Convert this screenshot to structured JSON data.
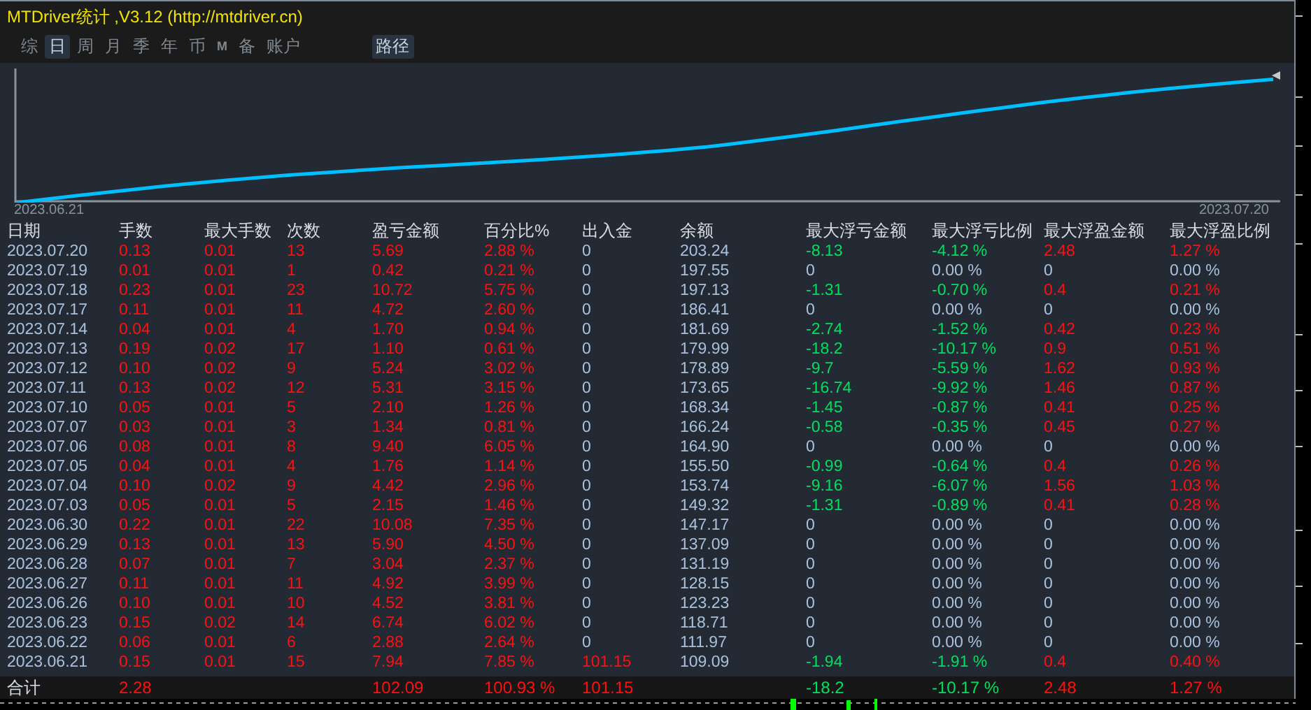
{
  "window": {
    "title": "MTDriver统计 ,V3.12 (http://mtdriver.cn)"
  },
  "tabs": [
    {
      "label": "综",
      "selected": false,
      "disabled": false
    },
    {
      "label": "日",
      "selected": true,
      "disabled": false
    },
    {
      "label": "周",
      "selected": false,
      "disabled": false
    },
    {
      "label": "月",
      "selected": false,
      "disabled": false
    },
    {
      "label": "季",
      "selected": false,
      "disabled": false
    },
    {
      "label": "年",
      "selected": false,
      "disabled": false
    },
    {
      "label": "币",
      "selected": false,
      "disabled": false
    },
    {
      "label": "M",
      "selected": false,
      "disabled": true
    },
    {
      "label": "备",
      "selected": false,
      "disabled": false
    },
    {
      "label": "账户",
      "selected": false,
      "disabled": false
    }
  ],
  "path_button": {
    "label": "路径",
    "selected": true
  },
  "chart": {
    "start_label": "2023.06.21",
    "end_label": "2023.07.20"
  },
  "table": {
    "columns": [
      "日期",
      "手数",
      "最大手数",
      "次数",
      "盈亏金额",
      "百分比%",
      "出入金",
      "余额",
      "最大浮亏金额",
      "最大浮亏比例",
      "最大浮盈金额",
      "最大浮盈比例"
    ],
    "rows": [
      {
        "cells": [
          {
            "text": "2023.07.20",
            "color": "#a9c1de"
          },
          {
            "text": "0.13",
            "color": "#ff1010"
          },
          {
            "text": "0.01",
            "color": "#ff1010"
          },
          {
            "text": "13",
            "color": "#ff1010"
          },
          {
            "text": "5.69",
            "color": "#ff1010"
          },
          {
            "text": "2.88 %",
            "color": "#ff1010"
          },
          {
            "text": "0",
            "color": "#a9c1de"
          },
          {
            "text": "203.24",
            "color": "#a9c1de"
          },
          {
            "text": "-8.13",
            "color": "#00e060"
          },
          {
            "text": "-4.12 %",
            "color": "#00e060"
          },
          {
            "text": "2.48",
            "color": "#ff1010"
          },
          {
            "text": "1.27 %",
            "color": "#ff1010"
          }
        ]
      },
      {
        "cells": [
          {
            "text": "2023.07.19",
            "color": "#a9c1de"
          },
          {
            "text": "0.01",
            "color": "#ff1010"
          },
          {
            "text": "0.01",
            "color": "#ff1010"
          },
          {
            "text": "1",
            "color": "#ff1010"
          },
          {
            "text": "0.42",
            "color": "#ff1010"
          },
          {
            "text": "0.21 %",
            "color": "#ff1010"
          },
          {
            "text": "0",
            "color": "#a9c1de"
          },
          {
            "text": "197.55",
            "color": "#a9c1de"
          },
          {
            "text": "0",
            "color": "#a9c1de"
          },
          {
            "text": "0.00 %",
            "color": "#a9c1de"
          },
          {
            "text": "0",
            "color": "#a9c1de"
          },
          {
            "text": "0.00 %",
            "color": "#a9c1de"
          }
        ]
      },
      {
        "cells": [
          {
            "text": "2023.07.18",
            "color": "#a9c1de"
          },
          {
            "text": "0.23",
            "color": "#ff1010"
          },
          {
            "text": "0.01",
            "color": "#ff1010"
          },
          {
            "text": "23",
            "color": "#ff1010"
          },
          {
            "text": "10.72",
            "color": "#ff1010"
          },
          {
            "text": "5.75 %",
            "color": "#ff1010"
          },
          {
            "text": "0",
            "color": "#a9c1de"
          },
          {
            "text": "197.13",
            "color": "#a9c1de"
          },
          {
            "text": "-1.31",
            "color": "#00e060"
          },
          {
            "text": "-0.70 %",
            "color": "#00e060"
          },
          {
            "text": "0.4",
            "color": "#ff1010"
          },
          {
            "text": "0.21 %",
            "color": "#ff1010"
          }
        ]
      },
      {
        "cells": [
          {
            "text": "2023.07.17",
            "color": "#a9c1de"
          },
          {
            "text": "0.11",
            "color": "#ff1010"
          },
          {
            "text": "0.01",
            "color": "#ff1010"
          },
          {
            "text": "11",
            "color": "#ff1010"
          },
          {
            "text": "4.72",
            "color": "#ff1010"
          },
          {
            "text": "2.60 %",
            "color": "#ff1010"
          },
          {
            "text": "0",
            "color": "#a9c1de"
          },
          {
            "text": "186.41",
            "color": "#a9c1de"
          },
          {
            "text": "0",
            "color": "#a9c1de"
          },
          {
            "text": "0.00 %",
            "color": "#a9c1de"
          },
          {
            "text": "0",
            "color": "#a9c1de"
          },
          {
            "text": "0.00 %",
            "color": "#a9c1de"
          }
        ]
      },
      {
        "cells": [
          {
            "text": "2023.07.14",
            "color": "#a9c1de"
          },
          {
            "text": "0.04",
            "color": "#ff1010"
          },
          {
            "text": "0.01",
            "color": "#ff1010"
          },
          {
            "text": "4",
            "color": "#ff1010"
          },
          {
            "text": "1.70",
            "color": "#ff1010"
          },
          {
            "text": "0.94 %",
            "color": "#ff1010"
          },
          {
            "text": "0",
            "color": "#a9c1de"
          },
          {
            "text": "181.69",
            "color": "#a9c1de"
          },
          {
            "text": "-2.74",
            "color": "#00e060"
          },
          {
            "text": "-1.52 %",
            "color": "#00e060"
          },
          {
            "text": "0.42",
            "color": "#ff1010"
          },
          {
            "text": "0.23 %",
            "color": "#ff1010"
          }
        ]
      },
      {
        "cells": [
          {
            "text": "2023.07.13",
            "color": "#a9c1de"
          },
          {
            "text": "0.19",
            "color": "#ff1010"
          },
          {
            "text": "0.02",
            "color": "#ff1010"
          },
          {
            "text": "17",
            "color": "#ff1010"
          },
          {
            "text": "1.10",
            "color": "#ff1010"
          },
          {
            "text": "0.61 %",
            "color": "#ff1010"
          },
          {
            "text": "0",
            "color": "#a9c1de"
          },
          {
            "text": "179.99",
            "color": "#a9c1de"
          },
          {
            "text": "-18.2",
            "color": "#00e060"
          },
          {
            "text": "-10.17 %",
            "color": "#00e060"
          },
          {
            "text": "0.9",
            "color": "#ff1010"
          },
          {
            "text": "0.51 %",
            "color": "#ff1010"
          }
        ]
      },
      {
        "cells": [
          {
            "text": "2023.07.12",
            "color": "#a9c1de"
          },
          {
            "text": "0.10",
            "color": "#ff1010"
          },
          {
            "text": "0.02",
            "color": "#ff1010"
          },
          {
            "text": "9",
            "color": "#ff1010"
          },
          {
            "text": "5.24",
            "color": "#ff1010"
          },
          {
            "text": "3.02 %",
            "color": "#ff1010"
          },
          {
            "text": "0",
            "color": "#a9c1de"
          },
          {
            "text": "178.89",
            "color": "#a9c1de"
          },
          {
            "text": "-9.7",
            "color": "#00e060"
          },
          {
            "text": "-5.59 %",
            "color": "#00e060"
          },
          {
            "text": "1.62",
            "color": "#ff1010"
          },
          {
            "text": "0.93 %",
            "color": "#ff1010"
          }
        ]
      },
      {
        "cells": [
          {
            "text": "2023.07.11",
            "color": "#a9c1de"
          },
          {
            "text": "0.13",
            "color": "#ff1010"
          },
          {
            "text": "0.02",
            "color": "#ff1010"
          },
          {
            "text": "12",
            "color": "#ff1010"
          },
          {
            "text": "5.31",
            "color": "#ff1010"
          },
          {
            "text": "3.15 %",
            "color": "#ff1010"
          },
          {
            "text": "0",
            "color": "#a9c1de"
          },
          {
            "text": "173.65",
            "color": "#a9c1de"
          },
          {
            "text": "-16.74",
            "color": "#00e060"
          },
          {
            "text": "-9.92 %",
            "color": "#00e060"
          },
          {
            "text": "1.46",
            "color": "#ff1010"
          },
          {
            "text": "0.87 %",
            "color": "#ff1010"
          }
        ]
      },
      {
        "cells": [
          {
            "text": "2023.07.10",
            "color": "#a9c1de"
          },
          {
            "text": "0.05",
            "color": "#ff1010"
          },
          {
            "text": "0.01",
            "color": "#ff1010"
          },
          {
            "text": "5",
            "color": "#ff1010"
          },
          {
            "text": "2.10",
            "color": "#ff1010"
          },
          {
            "text": "1.26 %",
            "color": "#ff1010"
          },
          {
            "text": "0",
            "color": "#a9c1de"
          },
          {
            "text": "168.34",
            "color": "#a9c1de"
          },
          {
            "text": "-1.45",
            "color": "#00e060"
          },
          {
            "text": "-0.87 %",
            "color": "#00e060"
          },
          {
            "text": "0.41",
            "color": "#ff1010"
          },
          {
            "text": "0.25 %",
            "color": "#ff1010"
          }
        ]
      },
      {
        "cells": [
          {
            "text": "2023.07.07",
            "color": "#a9c1de"
          },
          {
            "text": "0.03",
            "color": "#ff1010"
          },
          {
            "text": "0.01",
            "color": "#ff1010"
          },
          {
            "text": "3",
            "color": "#ff1010"
          },
          {
            "text": "1.34",
            "color": "#ff1010"
          },
          {
            "text": "0.81 %",
            "color": "#ff1010"
          },
          {
            "text": "0",
            "color": "#a9c1de"
          },
          {
            "text": "166.24",
            "color": "#a9c1de"
          },
          {
            "text": "-0.58",
            "color": "#00e060"
          },
          {
            "text": "-0.35 %",
            "color": "#00e060"
          },
          {
            "text": "0.45",
            "color": "#ff1010"
          },
          {
            "text": "0.27 %",
            "color": "#ff1010"
          }
        ]
      },
      {
        "cells": [
          {
            "text": "2023.07.06",
            "color": "#a9c1de"
          },
          {
            "text": "0.08",
            "color": "#ff1010"
          },
          {
            "text": "0.01",
            "color": "#ff1010"
          },
          {
            "text": "8",
            "color": "#ff1010"
          },
          {
            "text": "9.40",
            "color": "#ff1010"
          },
          {
            "text": "6.05 %",
            "color": "#ff1010"
          },
          {
            "text": "0",
            "color": "#a9c1de"
          },
          {
            "text": "164.90",
            "color": "#a9c1de"
          },
          {
            "text": "0",
            "color": "#a9c1de"
          },
          {
            "text": "0.00 %",
            "color": "#a9c1de"
          },
          {
            "text": "0",
            "color": "#a9c1de"
          },
          {
            "text": "0.00 %",
            "color": "#a9c1de"
          }
        ]
      },
      {
        "cells": [
          {
            "text": "2023.07.05",
            "color": "#a9c1de"
          },
          {
            "text": "0.04",
            "color": "#ff1010"
          },
          {
            "text": "0.01",
            "color": "#ff1010"
          },
          {
            "text": "4",
            "color": "#ff1010"
          },
          {
            "text": "1.76",
            "color": "#ff1010"
          },
          {
            "text": "1.14 %",
            "color": "#ff1010"
          },
          {
            "text": "0",
            "color": "#a9c1de"
          },
          {
            "text": "155.50",
            "color": "#a9c1de"
          },
          {
            "text": "-0.99",
            "color": "#00e060"
          },
          {
            "text": "-0.64 %",
            "color": "#00e060"
          },
          {
            "text": "0.4",
            "color": "#ff1010"
          },
          {
            "text": "0.26 %",
            "color": "#ff1010"
          }
        ]
      },
      {
        "cells": [
          {
            "text": "2023.07.04",
            "color": "#a9c1de"
          },
          {
            "text": "0.10",
            "color": "#ff1010"
          },
          {
            "text": "0.02",
            "color": "#ff1010"
          },
          {
            "text": "9",
            "color": "#ff1010"
          },
          {
            "text": "4.42",
            "color": "#ff1010"
          },
          {
            "text": "2.96 %",
            "color": "#ff1010"
          },
          {
            "text": "0",
            "color": "#a9c1de"
          },
          {
            "text": "153.74",
            "color": "#a9c1de"
          },
          {
            "text": "-9.16",
            "color": "#00e060"
          },
          {
            "text": "-6.07 %",
            "color": "#00e060"
          },
          {
            "text": "1.56",
            "color": "#ff1010"
          },
          {
            "text": "1.03 %",
            "color": "#ff1010"
          }
        ]
      },
      {
        "cells": [
          {
            "text": "2023.07.03",
            "color": "#a9c1de"
          },
          {
            "text": "0.05",
            "color": "#ff1010"
          },
          {
            "text": "0.01",
            "color": "#ff1010"
          },
          {
            "text": "5",
            "color": "#ff1010"
          },
          {
            "text": "2.15",
            "color": "#ff1010"
          },
          {
            "text": "1.46 %",
            "color": "#ff1010"
          },
          {
            "text": "0",
            "color": "#a9c1de"
          },
          {
            "text": "149.32",
            "color": "#a9c1de"
          },
          {
            "text": "-1.31",
            "color": "#00e060"
          },
          {
            "text": "-0.89 %",
            "color": "#00e060"
          },
          {
            "text": "0.41",
            "color": "#ff1010"
          },
          {
            "text": "0.28 %",
            "color": "#ff1010"
          }
        ]
      },
      {
        "cells": [
          {
            "text": "2023.06.30",
            "color": "#a9c1de"
          },
          {
            "text": "0.22",
            "color": "#ff1010"
          },
          {
            "text": "0.01",
            "color": "#ff1010"
          },
          {
            "text": "22",
            "color": "#ff1010"
          },
          {
            "text": "10.08",
            "color": "#ff1010"
          },
          {
            "text": "7.35 %",
            "color": "#ff1010"
          },
          {
            "text": "0",
            "color": "#a9c1de"
          },
          {
            "text": "147.17",
            "color": "#a9c1de"
          },
          {
            "text": "0",
            "color": "#a9c1de"
          },
          {
            "text": "0.00 %",
            "color": "#a9c1de"
          },
          {
            "text": "0",
            "color": "#a9c1de"
          },
          {
            "text": "0.00 %",
            "color": "#a9c1de"
          }
        ]
      },
      {
        "cells": [
          {
            "text": "2023.06.29",
            "color": "#a9c1de"
          },
          {
            "text": "0.13",
            "color": "#ff1010"
          },
          {
            "text": "0.01",
            "color": "#ff1010"
          },
          {
            "text": "13",
            "color": "#ff1010"
          },
          {
            "text": "5.90",
            "color": "#ff1010"
          },
          {
            "text": "4.50 %",
            "color": "#ff1010"
          },
          {
            "text": "0",
            "color": "#a9c1de"
          },
          {
            "text": "137.09",
            "color": "#a9c1de"
          },
          {
            "text": "0",
            "color": "#a9c1de"
          },
          {
            "text": "0.00 %",
            "color": "#a9c1de"
          },
          {
            "text": "0",
            "color": "#a9c1de"
          },
          {
            "text": "0.00 %",
            "color": "#a9c1de"
          }
        ]
      },
      {
        "cells": [
          {
            "text": "2023.06.28",
            "color": "#a9c1de"
          },
          {
            "text": "0.07",
            "color": "#ff1010"
          },
          {
            "text": "0.01",
            "color": "#ff1010"
          },
          {
            "text": "7",
            "color": "#ff1010"
          },
          {
            "text": "3.04",
            "color": "#ff1010"
          },
          {
            "text": "2.37 %",
            "color": "#ff1010"
          },
          {
            "text": "0",
            "color": "#a9c1de"
          },
          {
            "text": "131.19",
            "color": "#a9c1de"
          },
          {
            "text": "0",
            "color": "#a9c1de"
          },
          {
            "text": "0.00 %",
            "color": "#a9c1de"
          },
          {
            "text": "0",
            "color": "#a9c1de"
          },
          {
            "text": "0.00 %",
            "color": "#a9c1de"
          }
        ]
      },
      {
        "cells": [
          {
            "text": "2023.06.27",
            "color": "#a9c1de"
          },
          {
            "text": "0.11",
            "color": "#ff1010"
          },
          {
            "text": "0.01",
            "color": "#ff1010"
          },
          {
            "text": "11",
            "color": "#ff1010"
          },
          {
            "text": "4.92",
            "color": "#ff1010"
          },
          {
            "text": "3.99 %",
            "color": "#ff1010"
          },
          {
            "text": "0",
            "color": "#a9c1de"
          },
          {
            "text": "128.15",
            "color": "#a9c1de"
          },
          {
            "text": "0",
            "color": "#a9c1de"
          },
          {
            "text": "0.00 %",
            "color": "#a9c1de"
          },
          {
            "text": "0",
            "color": "#a9c1de"
          },
          {
            "text": "0.00 %",
            "color": "#a9c1de"
          }
        ]
      },
      {
        "cells": [
          {
            "text": "2023.06.26",
            "color": "#a9c1de"
          },
          {
            "text": "0.10",
            "color": "#ff1010"
          },
          {
            "text": "0.01",
            "color": "#ff1010"
          },
          {
            "text": "10",
            "color": "#ff1010"
          },
          {
            "text": "4.52",
            "color": "#ff1010"
          },
          {
            "text": "3.81 %",
            "color": "#ff1010"
          },
          {
            "text": "0",
            "color": "#a9c1de"
          },
          {
            "text": "123.23",
            "color": "#a9c1de"
          },
          {
            "text": "0",
            "color": "#a9c1de"
          },
          {
            "text": "0.00 %",
            "color": "#a9c1de"
          },
          {
            "text": "0",
            "color": "#a9c1de"
          },
          {
            "text": "0.00 %",
            "color": "#a9c1de"
          }
        ]
      },
      {
        "cells": [
          {
            "text": "2023.06.23",
            "color": "#a9c1de"
          },
          {
            "text": "0.15",
            "color": "#ff1010"
          },
          {
            "text": "0.02",
            "color": "#ff1010"
          },
          {
            "text": "14",
            "color": "#ff1010"
          },
          {
            "text": "6.74",
            "color": "#ff1010"
          },
          {
            "text": "6.02 %",
            "color": "#ff1010"
          },
          {
            "text": "0",
            "color": "#a9c1de"
          },
          {
            "text": "118.71",
            "color": "#a9c1de"
          },
          {
            "text": "0",
            "color": "#a9c1de"
          },
          {
            "text": "0.00 %",
            "color": "#a9c1de"
          },
          {
            "text": "0",
            "color": "#a9c1de"
          },
          {
            "text": "0.00 %",
            "color": "#a9c1de"
          }
        ]
      },
      {
        "cells": [
          {
            "text": "2023.06.22",
            "color": "#a9c1de"
          },
          {
            "text": "0.06",
            "color": "#ff1010"
          },
          {
            "text": "0.01",
            "color": "#ff1010"
          },
          {
            "text": "6",
            "color": "#ff1010"
          },
          {
            "text": "2.88",
            "color": "#ff1010"
          },
          {
            "text": "2.64 %",
            "color": "#ff1010"
          },
          {
            "text": "0",
            "color": "#a9c1de"
          },
          {
            "text": "111.97",
            "color": "#a9c1de"
          },
          {
            "text": "0",
            "color": "#a9c1de"
          },
          {
            "text": "0.00 %",
            "color": "#a9c1de"
          },
          {
            "text": "0",
            "color": "#a9c1de"
          },
          {
            "text": "0.00 %",
            "color": "#a9c1de"
          }
        ]
      },
      {
        "cells": [
          {
            "text": "2023.06.21",
            "color": "#a9c1de"
          },
          {
            "text": "0.15",
            "color": "#ff1010"
          },
          {
            "text": "0.01",
            "color": "#ff1010"
          },
          {
            "text": "15",
            "color": "#ff1010"
          },
          {
            "text": "7.94",
            "color": "#ff1010"
          },
          {
            "text": "7.85 %",
            "color": "#ff1010"
          },
          {
            "text": "101.15",
            "color": "#ff1010"
          },
          {
            "text": "109.09",
            "color": "#a9c1de"
          },
          {
            "text": "-1.94",
            "color": "#00e060"
          },
          {
            "text": "-1.91 %",
            "color": "#00e060"
          },
          {
            "text": "0.4",
            "color": "#ff1010"
          },
          {
            "text": "0.40 %",
            "color": "#ff1010"
          }
        ]
      }
    ],
    "total": {
      "cells": [
        {
          "text": "合计",
          "color": "#d7dde4"
        },
        {
          "text": "2.28",
          "color": "#ff1010"
        },
        null,
        null,
        {
          "text": "102.09",
          "color": "#ff1010"
        },
        {
          "text": "100.93 %",
          "color": "#ff1010"
        },
        {
          "text": "101.15",
          "color": "#ff1010"
        },
        null,
        {
          "text": "-18.2",
          "color": "#00e060"
        },
        {
          "text": "-10.17 %",
          "color": "#00e060"
        },
        {
          "text": "2.48",
          "color": "#ff1010"
        },
        {
          "text": "1.27 %",
          "color": "#ff1010"
        }
      ]
    }
  }
}
